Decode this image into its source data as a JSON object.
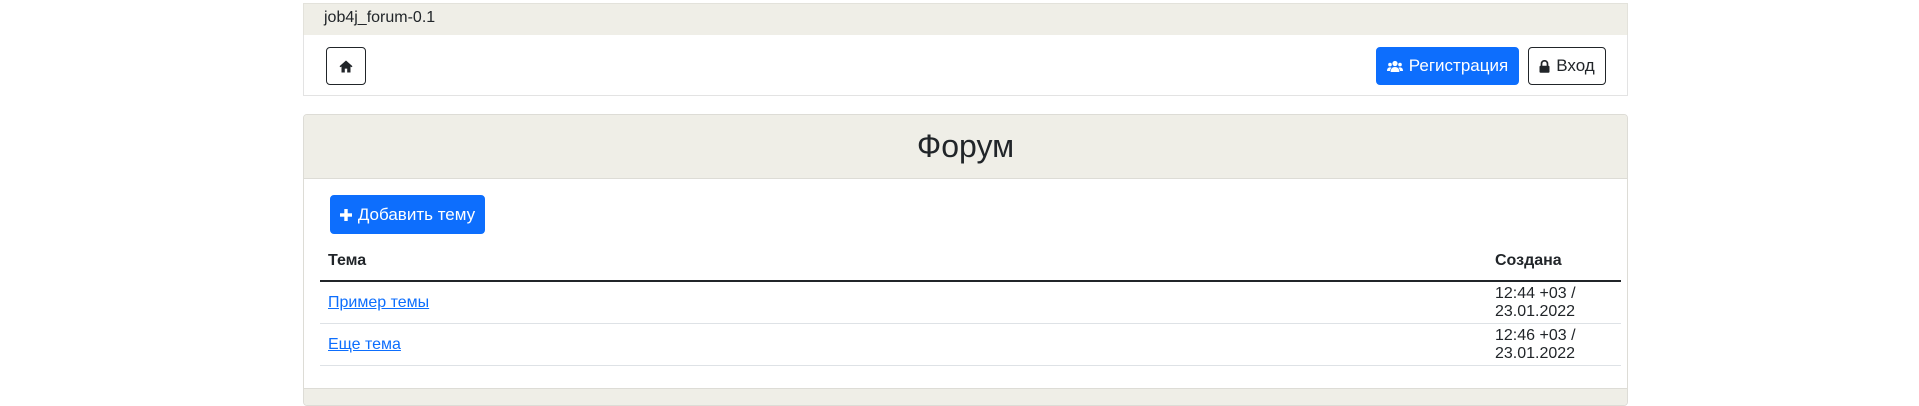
{
  "app": {
    "brand": "job4j_forum-0.1"
  },
  "nav": {
    "home_icon": "home-icon",
    "register_label": "Регистрация",
    "register_icon": "users-icon",
    "login_label": "Вход",
    "login_icon": "lock-icon"
  },
  "forum": {
    "title": "Форум",
    "add_topic_label": "Добавить тему",
    "add_topic_icon": "plus-icon",
    "columns": [
      "Тема",
      "Создана"
    ],
    "rows": [
      {
        "topic": "Пример темы",
        "created": "12:44 +03 / 23.01.2022"
      },
      {
        "topic": "Еще тема",
        "created": "12:46 +03 / 23.01.2022"
      }
    ]
  },
  "colors": {
    "primary": "#0d6efd",
    "header_bg": "#efeee7",
    "text": "#212529"
  }
}
